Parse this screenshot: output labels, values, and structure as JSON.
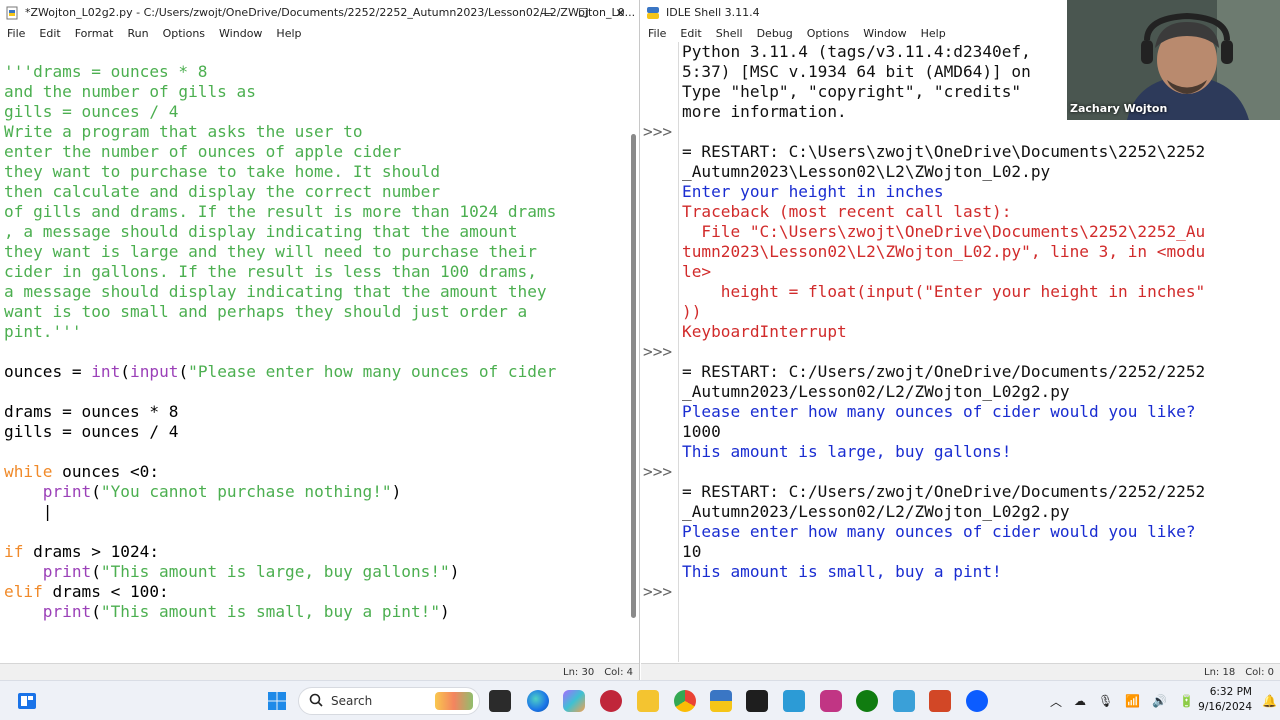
{
  "editor": {
    "title": "*ZWojton_L02g2.py - C:/Users/zwojt/OneDrive/Documents/2252/2252_Autumn2023/Lesson02/L2/ZWojton_L0...",
    "menu": [
      "File",
      "Edit",
      "Format",
      "Run",
      "Options",
      "Window",
      "Help"
    ],
    "status_line": "Ln: 30",
    "status_col": "Col: 4",
    "code_lines": [
      [
        [
          "s",
          "'''drams = ounces * 8"
        ]
      ],
      [
        [
          "s",
          "and the number of gills as"
        ]
      ],
      [
        [
          "s",
          "gills = ounces / 4"
        ]
      ],
      [
        [
          "s",
          "Write a program that asks the user to"
        ]
      ],
      [
        [
          "s",
          "enter the number of ounces of apple cider"
        ]
      ],
      [
        [
          "s",
          "they want to purchase to take home. It should"
        ]
      ],
      [
        [
          "s",
          "then calculate and display the correct number"
        ]
      ],
      [
        [
          "s",
          "of gills and drams. If the result is more than 1024 drams"
        ]
      ],
      [
        [
          "s",
          ", a message should display indicating that the amount"
        ]
      ],
      [
        [
          "s",
          "they want is large and they will need to purchase their"
        ]
      ],
      [
        [
          "s",
          "cider in gallons. If the result is less than 100 drams,"
        ]
      ],
      [
        [
          "s",
          "a message should display indicating that the amount they"
        ]
      ],
      [
        [
          "s",
          "want is too small and perhaps they should just order a"
        ]
      ],
      [
        [
          "s",
          "pint.'''"
        ]
      ],
      [],
      [
        [
          "i",
          "ounces = "
        ],
        [
          "b",
          "int"
        ],
        [
          "i",
          "("
        ],
        [
          "b",
          "input"
        ],
        [
          "i",
          "("
        ],
        [
          "s",
          "\"Please enter how many ounces of cider"
        ]
      ],
      [],
      [
        [
          "i",
          "drams = ounces * 8"
        ]
      ],
      [
        [
          "i",
          "gills = ounces / 4"
        ]
      ],
      [],
      [
        [
          "k",
          "while"
        ],
        [
          "i",
          " ounces <0:"
        ]
      ],
      [
        [
          "i",
          "    "
        ],
        [
          "b",
          "print"
        ],
        [
          "i",
          "("
        ],
        [
          "s",
          "\"You cannot purchase nothing!\""
        ],
        [
          "i",
          ")"
        ]
      ],
      [
        [
          "i",
          "    |"
        ]
      ],
      [],
      [
        [
          "k",
          "if"
        ],
        [
          "i",
          " drams > 1024:"
        ]
      ],
      [
        [
          "i",
          "    "
        ],
        [
          "b",
          "print"
        ],
        [
          "i",
          "("
        ],
        [
          "s",
          "\"This amount is large, buy gallons!\""
        ],
        [
          "i",
          ")"
        ]
      ],
      [
        [
          "k",
          "elif"
        ],
        [
          "i",
          " drams < 100:"
        ]
      ],
      [
        [
          "i",
          "    "
        ],
        [
          "b",
          "print"
        ],
        [
          "i",
          "("
        ],
        [
          "s",
          "\"This amount is small, buy a pint!\""
        ],
        [
          "i",
          ")"
        ]
      ]
    ]
  },
  "shell": {
    "title": "IDLE Shell 3.11.4",
    "menu": [
      "File",
      "Edit",
      "Shell",
      "Debug",
      "Options",
      "Window",
      "Help"
    ],
    "status_line": "Ln: 18",
    "status_col": "Col: 0",
    "prompt": ">>>",
    "lines": [
      {
        "p": "",
        "c": "n",
        "t": "Python 3.11.4 (tags/v3.11.4:d2340ef,"
      },
      {
        "p": "",
        "c": "n",
        "t": "5:37) [MSC v.1934 64 bit (AMD64)] on"
      },
      {
        "p": "",
        "c": "n",
        "t": "Type \"help\", \"copyright\", \"credits\""
      },
      {
        "p": "",
        "c": "n",
        "t": "more information."
      },
      {
        "p": ">>>",
        "c": "n",
        "t": ""
      },
      {
        "p": "",
        "c": "n",
        "t": "= RESTART: C:\\Users\\zwojt\\OneDrive\\Documents\\2252\\2252"
      },
      {
        "p": "",
        "c": "n",
        "t": "_Autumn2023\\Lesson02\\L2\\ZWojton_L02.py"
      },
      {
        "p": "",
        "c": "b",
        "t": "Enter your height in inches"
      },
      {
        "p": "",
        "c": "r",
        "t": "Traceback (most recent call last):"
      },
      {
        "p": "",
        "c": "r",
        "t": "  File \"C:\\Users\\zwojt\\OneDrive\\Documents\\2252\\2252_Au"
      },
      {
        "p": "",
        "c": "r",
        "t": "tumn2023\\Lesson02\\L2\\ZWojton_L02.py\", line 3, in <modu"
      },
      {
        "p": "",
        "c": "r",
        "t": "le>"
      },
      {
        "p": "",
        "c": "r",
        "t": "    height = float(input(\"Enter your height in inches\""
      },
      {
        "p": "",
        "c": "r",
        "t": "))"
      },
      {
        "p": "",
        "c": "r",
        "t": "KeyboardInterrupt"
      },
      {
        "p": ">>>",
        "c": "n",
        "t": ""
      },
      {
        "p": "",
        "c": "n",
        "t": "= RESTART: C:/Users/zwojt/OneDrive/Documents/2252/2252"
      },
      {
        "p": "",
        "c": "n",
        "t": "_Autumn2023/Lesson02/L2/ZWojton_L02g2.py"
      },
      {
        "p": "",
        "c": "b",
        "t": "Please enter how many ounces of cider would you like?"
      },
      {
        "p": "",
        "c": "n",
        "t": "1000"
      },
      {
        "p": "",
        "c": "b",
        "t": "This amount is large, buy gallons!"
      },
      {
        "p": ">>>",
        "c": "n",
        "t": ""
      },
      {
        "p": "",
        "c": "n",
        "t": "= RESTART: C:/Users/zwojt/OneDrive/Documents/2252/2252"
      },
      {
        "p": "",
        "c": "n",
        "t": "_Autumn2023/Lesson02/L2/ZWojton_L02g2.py"
      },
      {
        "p": "",
        "c": "b",
        "t": "Please enter how many ounces of cider would you like?"
      },
      {
        "p": "",
        "c": "n",
        "t": "10"
      },
      {
        "p": "",
        "c": "b",
        "t": "This amount is small, buy a pint!"
      },
      {
        "p": ">>>",
        "c": "n",
        "t": ""
      }
    ]
  },
  "webcam": {
    "name": "Zachary Wojton"
  },
  "taskbar": {
    "search_label": "Search",
    "clock_time": "6:32 PM",
    "clock_date": "9/16/2024"
  },
  "colors": {
    "string": "#4caf50",
    "keyword": "#f08a2a",
    "builtin": "#9b40b8",
    "shell_blue": "#1a2dd1",
    "shell_red": "#d12b2b"
  }
}
